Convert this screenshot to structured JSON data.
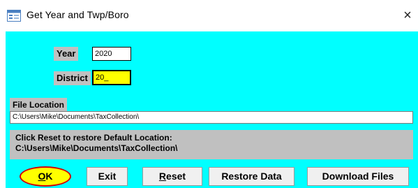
{
  "window": {
    "title": "Get Year and Twp/Boro",
    "close_glyph": "×",
    "app_icon": "form-icon"
  },
  "form": {
    "year_label": "Year",
    "year_value": "2020",
    "district_label": "District",
    "district_value": "20_",
    "file_location_label": "File Location",
    "file_location_value": "C:\\Users\\Mike\\Documents\\TaxCollection\\",
    "info_line1": "Click Reset to restore Default Location:",
    "info_line2": "C:\\Users\\Mike\\Documents\\TaxCollection\\"
  },
  "buttons": {
    "ok_mnemonic": "O",
    "ok_rest": "K",
    "exit": "Exit",
    "reset_mnemonic": "R",
    "reset_rest": "eset",
    "restore_data": "Restore Data",
    "download_files": "Download Files"
  },
  "colors": {
    "background": "#00ffff",
    "label_bg": "#c0c0c0",
    "highlight": "#ffff00",
    "ok_ring": "#d40000"
  }
}
